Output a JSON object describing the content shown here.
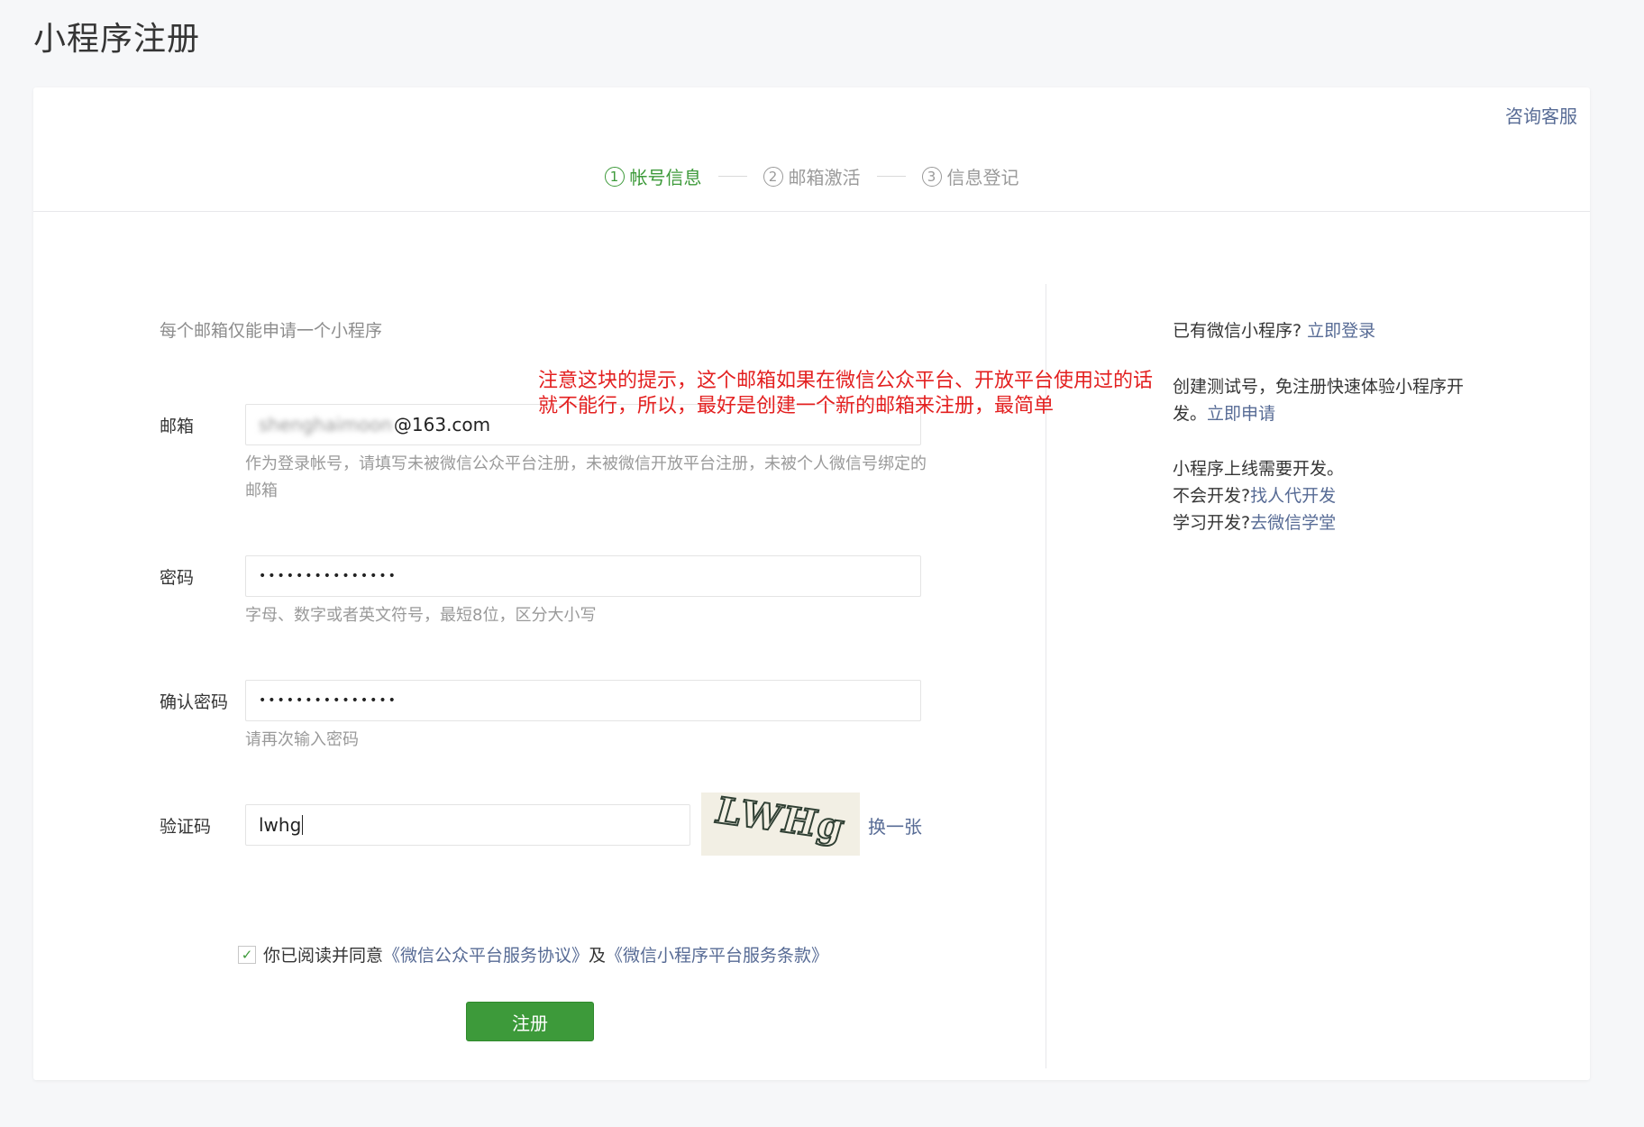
{
  "page_title": "小程序注册",
  "support_link": "咨询客服",
  "steps": [
    {
      "num": "1",
      "label": "帐号信息",
      "active": true
    },
    {
      "num": "2",
      "label": "邮箱激活",
      "active": false
    },
    {
      "num": "3",
      "label": "信息登记",
      "active": false
    }
  ],
  "form": {
    "tip": "每个邮箱仅能申请一个小程序",
    "email": {
      "label": "邮箱",
      "value_blurred": "shenghaimoon",
      "value_domain": "@163.com",
      "hint": "作为登录帐号，请填写未被微信公众平台注册，未被微信开放平台注册，未被个人微信号绑定的邮箱"
    },
    "password": {
      "label": "密码",
      "value": "•••••••••••••••",
      "hint": "字母、数字或者英文符号，最短8位，区分大小写"
    },
    "confirm_password": {
      "label": "确认密码",
      "value": "•••••••••••••••",
      "hint": "请再次输入密码"
    },
    "captcha": {
      "label": "验证码",
      "value": "lwhg",
      "image_text": "LWHg",
      "refresh_label": "换一张"
    },
    "agreement": {
      "prefix": "你已阅读并同意",
      "link1": "《微信公众平台服务协议》",
      "conj": "及",
      "link2": "《微信小程序平台服务条款》",
      "checked": true
    },
    "submit_label": "注册"
  },
  "side": {
    "login_prompt": "已有微信小程序?",
    "login_link": "立即登录",
    "test_prompt": "创建测试号，免注册快速体验小程序开发。",
    "test_link": "立即申请",
    "dev_line": "小程序上线需要开发。",
    "dev_prompt1": "不会开发?",
    "dev_link1": "找人代开发",
    "dev_prompt2": "学习开发?",
    "dev_link2": "去微信学堂"
  },
  "annotation": {
    "line1": "注意这块的提示，这个邮箱如果在微信公众平台、开放平台使用过的话",
    "line2": "就不能行，所以，最好是创建一个新的邮箱来注册，最简单"
  },
  "colors": {
    "accent_green": "#3d9a3a",
    "link_blue": "#576b95",
    "annotation_red": "#e32020"
  }
}
